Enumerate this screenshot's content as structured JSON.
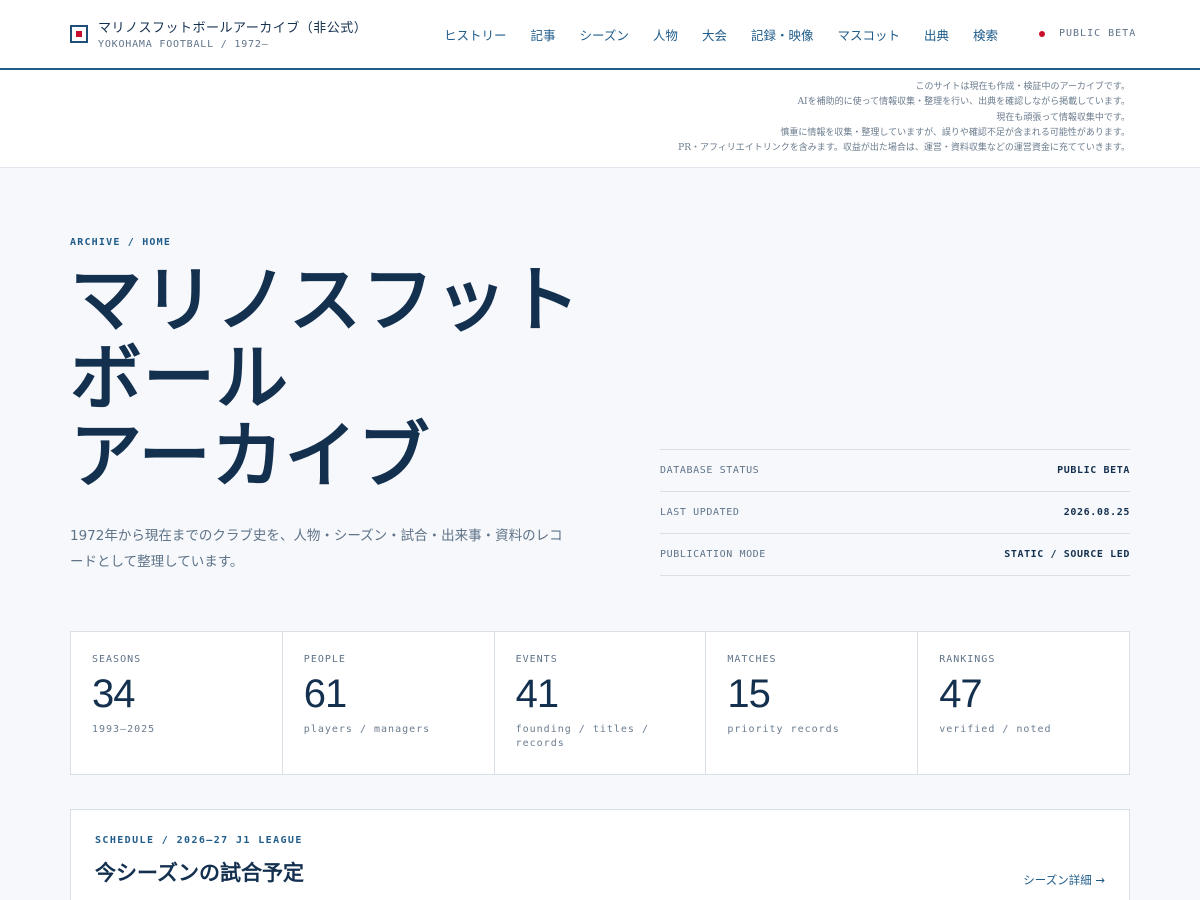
{
  "header": {
    "site_title": "マリノスフットボールアーカイブ（非公式）",
    "site_subtitle": "YOKOHAMA FOOTBALL / 1972—",
    "nav": [
      "ヒストリー",
      "記事",
      "シーズン",
      "人物",
      "大会",
      "記録・映像",
      "マスコット",
      "出典",
      "検索"
    ],
    "beta_label": "PUBLIC BETA",
    "accent_color": "#1f5c8a",
    "beta_dot_color": "#c8102e"
  },
  "notice": {
    "lines": [
      "このサイトは現在も作成・検証中のアーカイブです。",
      "AIを補助的に使って情報収集・整理を行い、出典を確認しながら掲載しています。",
      "現在も頑張って情報収集中です。",
      "慎重に情報を収集・整理していますが、誤りや確認不足が含まれる可能性があります。",
      "PR・アフィリエイトリンクを含みます。収益が出た場合は、運営・資料収集などの運営資金に充てていきます。"
    ]
  },
  "hero": {
    "breadcrumb": "ARCHIVE / HOME",
    "title_lines": [
      "マリノスフットボール",
      "ボール",
      "アーカイブ"
    ],
    "title_line1": "マリノスフット",
    "title_line2": "ボール",
    "title_line3": "アーカイブ",
    "description": "1972年から現在までのクラブ史を、人物・シーズン・試合・出来事・資料のレコードとして整理しています。"
  },
  "status": [
    {
      "key": "DATABASE STATUS",
      "value": "PUBLIC BETA"
    },
    {
      "key": "LAST UPDATED",
      "value": "2026.08.25"
    },
    {
      "key": "PUBLICATION MODE",
      "value": "STATIC / SOURCE LED"
    }
  ],
  "stats": [
    {
      "label": "SEASONS",
      "value": "34",
      "sub": "1993—2025"
    },
    {
      "label": "PEOPLE",
      "value": "61",
      "sub": "players / managers"
    },
    {
      "label": "EVENTS",
      "value": "41",
      "sub": "founding / titles / records"
    },
    {
      "label": "MATCHES",
      "value": "15",
      "sub": "priority records"
    },
    {
      "label": "RANKINGS",
      "value": "47",
      "sub": "verified / noted"
    }
  ],
  "schedule": {
    "eyebrow": "SCHEDULE / 2026–27 J1 LEAGUE",
    "title": "今シーズンの試合予定",
    "link": "シーズン詳細 →"
  }
}
